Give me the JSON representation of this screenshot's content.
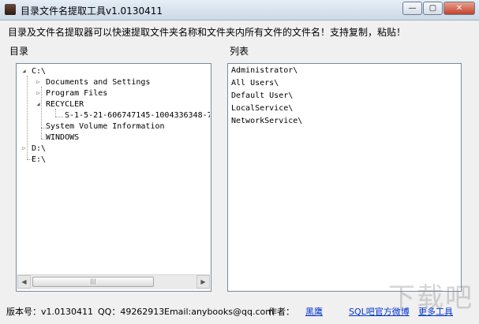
{
  "window": {
    "title": "目录文件名提取工具v1.0130411",
    "minimize_glyph": "—",
    "maximize_glyph": "▢",
    "close_glyph": "✕"
  },
  "description": "目录及文件名提取器可以快速提取文件夹名称和文件夹内所有文件的文件名！支持复制，粘贴！",
  "tree": {
    "label": "目录",
    "nodes": [
      {
        "text": "C:\\",
        "toggle": "◢"
      },
      {
        "text": "Documents and Settings",
        "toggle": "▷"
      },
      {
        "text": "Program Files",
        "toggle": "▷"
      },
      {
        "text": "RECYCLER",
        "toggle": "◢"
      },
      {
        "text": "S-1-5-21-606747145-1004336348-7",
        "toggle": ""
      },
      {
        "text": "System Volume Information",
        "toggle": ""
      },
      {
        "text": "WINDOWS",
        "toggle": ""
      },
      {
        "text": "D:\\",
        "toggle": "▷"
      },
      {
        "text": "E:\\",
        "toggle": ""
      }
    ],
    "scroll": {
      "left": "◀",
      "right": "▶",
      "grip": "|||"
    }
  },
  "list": {
    "label": "列表",
    "items": [
      "Administrator\\",
      "All Users\\",
      "Default User\\",
      "LocalService\\",
      "NetworkService\\"
    ]
  },
  "footer": {
    "version": "版本号：v1.0130411",
    "qq": "QQ：49262913",
    "email": "Email:anybooks@qq.com",
    "author_label": "作者：",
    "author_name": "黑鹰",
    "weibo_link": "SQL吧官方微博",
    "more_tools": "更多工具"
  },
  "watermark": "下载吧",
  "colors": {
    "link": "#0033cc",
    "panel_border": "#7a8a9c",
    "background": "#f0f0f0"
  }
}
